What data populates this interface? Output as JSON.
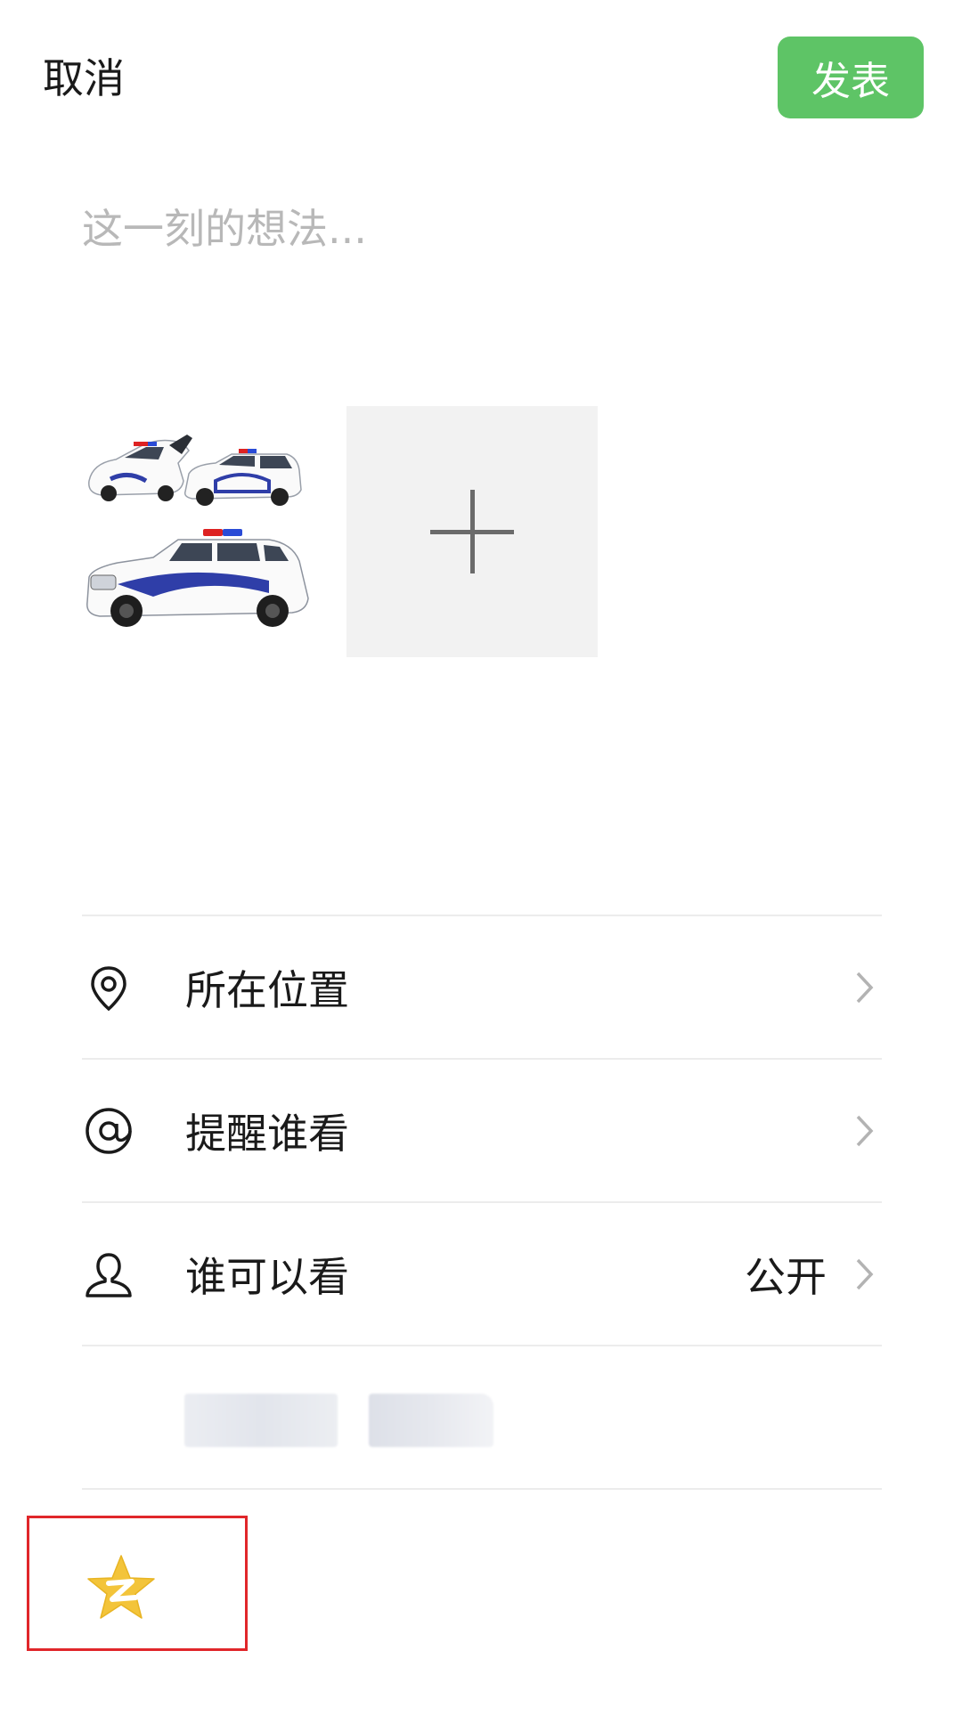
{
  "header": {
    "cancel_label": "取消",
    "publish_label": "发表"
  },
  "composer": {
    "placeholder": "这一刻的想法..."
  },
  "media": {
    "add_photo_icon": "plus-icon"
  },
  "options": [
    {
      "label": "所在位置",
      "value": "",
      "icon": "location-pin-icon"
    },
    {
      "label": "提醒谁看",
      "value": "",
      "icon": "at-sign-icon"
    },
    {
      "label": "谁可以看",
      "value": "公开",
      "icon": "person-icon"
    }
  ],
  "share_target": {
    "icon": "qzone-star-icon"
  },
  "colors": {
    "accent": "#5ec466",
    "highlight": "#e0262a",
    "qzone_star": "#f3c43a"
  }
}
